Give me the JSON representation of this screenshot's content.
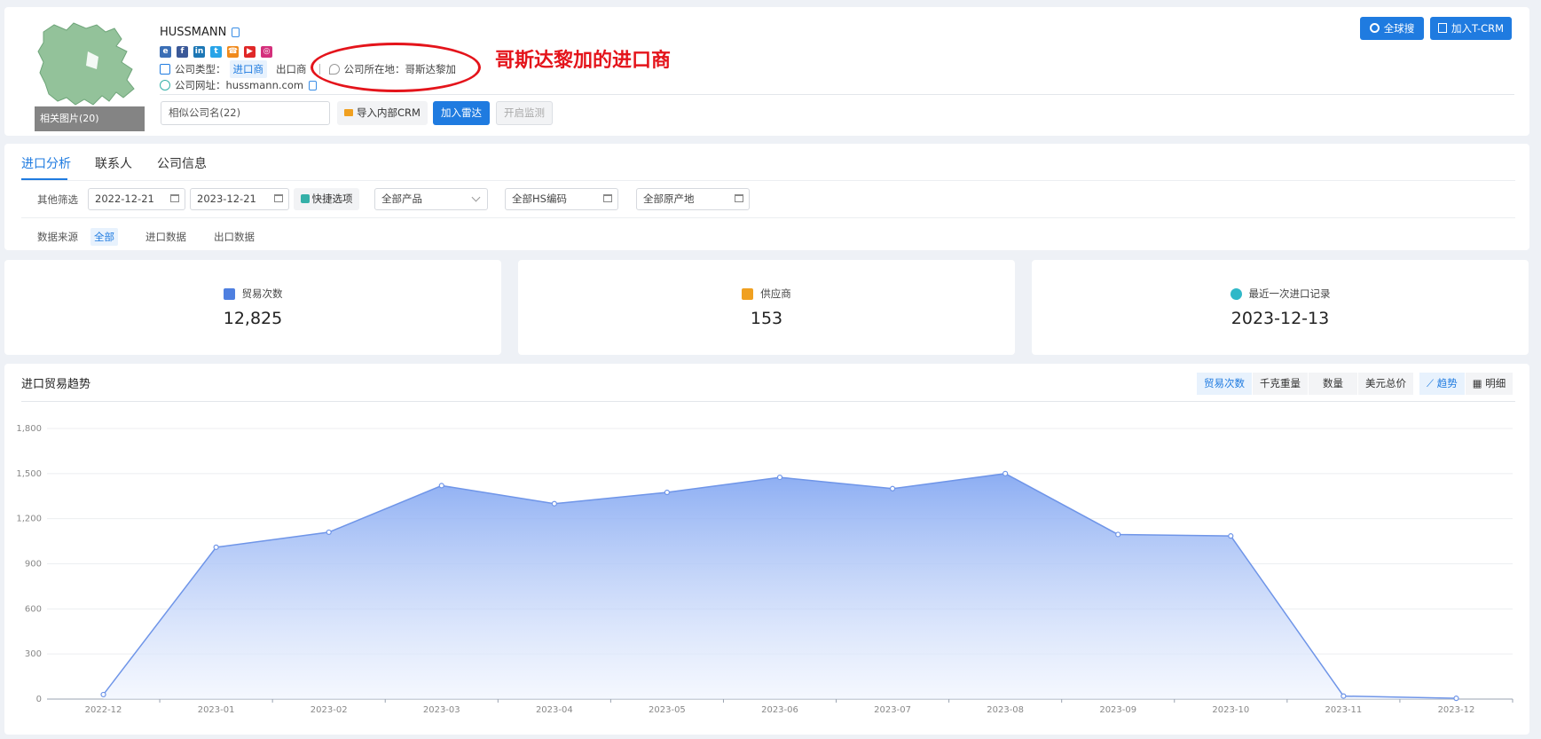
{
  "company": {
    "name": "HUSSMANN",
    "thumb_caption": "相关图片(20)",
    "type_label": "公司类型：",
    "type_importer": "进口商",
    "type_exporter": "出口商",
    "location_label": "公司所在地：",
    "location_value": "哥斯达黎加",
    "website_label": "公司网址：",
    "website_value": "hussmann.com",
    "social_icons": [
      "ie-icon",
      "facebook-icon",
      "linkedin-icon",
      "twitter-icon",
      "phone-icon",
      "youtube-icon",
      "instagram-icon"
    ]
  },
  "annotation": {
    "text": "哥斯达黎加的进口商"
  },
  "actions": {
    "similar_placeholder": "相似公司名(22)",
    "import_crm": "导入内部CRM",
    "add_radar": "加入雷达",
    "start_monitor": "开启监测",
    "global_search": "全球搜",
    "add_tcrm": "加入T-CRM"
  },
  "tabs": [
    {
      "label": "进口分析",
      "active": true
    },
    {
      "label": "联系人",
      "active": false
    },
    {
      "label": "公司信息",
      "active": false
    }
  ],
  "filters": {
    "other_label": "其他筛选",
    "date_from": "2022-12-21",
    "date_to": "2023-12-21",
    "quick_options": "快捷选项",
    "product": "全部产品",
    "hs_code": "全部HS编码",
    "origin": "全部原产地",
    "source_label": "数据来源",
    "source_all": "全部",
    "source_import": "进口数据",
    "source_export": "出口数据"
  },
  "stats": [
    {
      "label": "贸易次数",
      "value": "12,825",
      "icon_color": "#4e7fe0"
    },
    {
      "label": "供应商",
      "value": "153",
      "icon_color": "#f0a020"
    },
    {
      "label": "最近一次进口记录",
      "value": "2023-12-13",
      "icon_color": "#30b8c8"
    }
  ],
  "chart_header": {
    "title": "进口贸易趋势",
    "metrics": [
      "贸易次数",
      "千克重量",
      "数量",
      "美元总价"
    ],
    "active_metric": "贸易次数",
    "views": [
      "趋势",
      "明细"
    ],
    "active_view": "趋势"
  },
  "colors": {
    "accent": "#1f7be0",
    "annotation": "#e4141b",
    "area_top": "#86a9f2",
    "line": "#6f95e8"
  },
  "chart_data": {
    "type": "area",
    "categories": [
      "2022-12",
      "2023-01",
      "2023-02",
      "2023-03",
      "2023-04",
      "2023-05",
      "2023-06",
      "2023-07",
      "2023-08",
      "2023-09",
      "2023-10",
      "2023-11",
      "2023-12"
    ],
    "series": [
      {
        "values": [
          30,
          1010,
          1110,
          1420,
          1300,
          1375,
          1475,
          1400,
          1500,
          1095,
          1085,
          20,
          5
        ]
      }
    ],
    "yticks": [
      0,
      300,
      600,
      900,
      1200,
      1500,
      1800
    ],
    "ytick_labels": [
      "0",
      "300",
      "600",
      "900",
      "1,200",
      "1,500",
      "1,800"
    ],
    "ylim": [
      0,
      1800
    ],
    "grid": true,
    "title": "",
    "xlabel": "",
    "ylabel": ""
  }
}
